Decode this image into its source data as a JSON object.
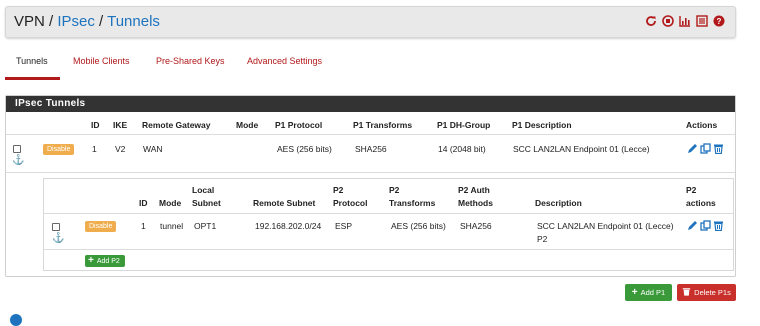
{
  "breadcrumb": {
    "part1": "VPN",
    "sep1": " / ",
    "part2": "IPsec",
    "sep2": " / ",
    "part3": "Tunnels"
  },
  "header_icons": [
    "reload-icon",
    "stop-icon",
    "chart-icon",
    "list-icon",
    "help-icon"
  ],
  "tabs": [
    {
      "label": "Tunnels",
      "active": true
    },
    {
      "label": "Mobile Clients",
      "active": false
    },
    {
      "label": "Pre-Shared Keys",
      "active": false
    },
    {
      "label": "Advanced Settings",
      "active": false
    }
  ],
  "panel": {
    "title": "IPsec Tunnels",
    "columns": [
      "ID",
      "IKE",
      "Remote Gateway",
      "Mode",
      "P1 Protocol",
      "P1 Transforms",
      "P1 DH-Group",
      "P1 Description",
      "Actions"
    ],
    "p1": {
      "disable_label": "Disable",
      "id": "1",
      "ike": "V2",
      "remote_gateway": "WAN",
      "mode": "",
      "protocol": "AES (256 bits)",
      "transforms": "SHA256",
      "dh_group": "14 (2048 bit)",
      "description": "SCC LAN2LAN Endpoint 01 (Lecce)"
    },
    "p2_columns": {
      "id": "ID",
      "mode": "Mode",
      "local_subnet": [
        "Local",
        "Subnet"
      ],
      "remote_subnet": "Remote Subnet",
      "protocol": [
        "P2",
        "Protocol"
      ],
      "transforms": [
        "P2",
        "Transforms"
      ],
      "auth": [
        "P2 Auth",
        "Methods"
      ],
      "description": "Description",
      "actions": [
        "P2",
        "actions"
      ]
    },
    "p2": {
      "disable_label": "Disable",
      "id": "1",
      "mode": "tunnel",
      "local_subnet": "OPT1",
      "remote_subnet": "192.168.202.0/24",
      "protocol": "ESP",
      "transforms": "AES (256 bits)",
      "auth": "SHA256",
      "description_line1": "SCC LAN2LAN Endpoint 01 (Lecce)",
      "description_line2": "P2"
    },
    "add_p2_label": "Add P2"
  },
  "footer": {
    "add_p1_label": "Add P1",
    "delete_p1_label": "Delete P1s"
  },
  "colors": {
    "accent": "#b2191b",
    "link": "#1e73be",
    "success": "#3a9a3a",
    "danger": "#c9302c",
    "warning": "#f0ad4e",
    "panel_head": "#333333"
  }
}
